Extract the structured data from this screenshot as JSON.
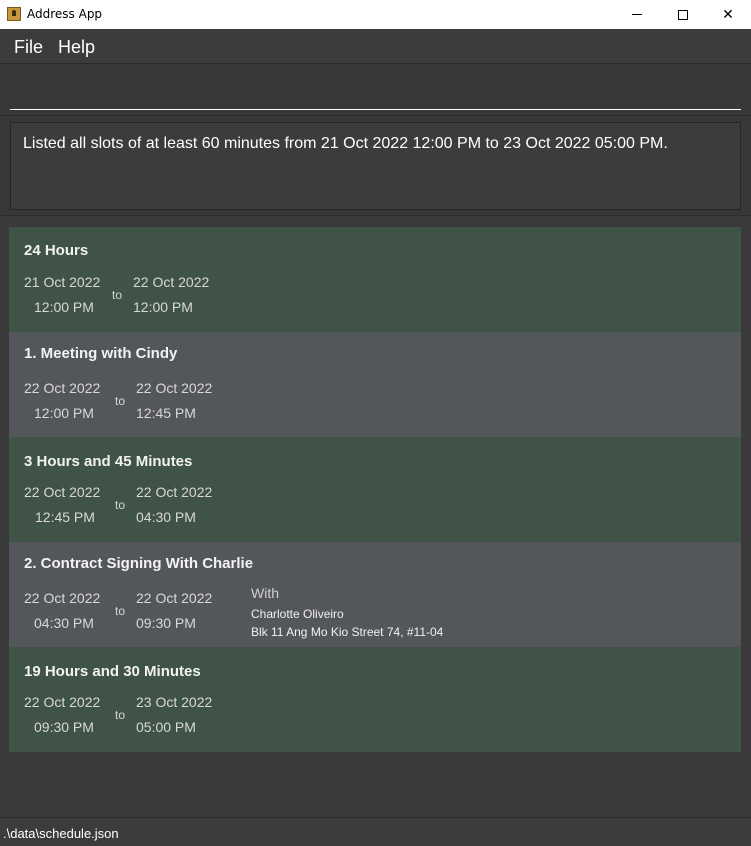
{
  "window": {
    "title": "Address App",
    "icon": "app-icon",
    "controls": {
      "minimize": "minimize-icon",
      "maximize": "maximize-icon",
      "close": "✕"
    }
  },
  "menu": {
    "file": "File",
    "help": "Help"
  },
  "command": {
    "value": "",
    "placeholder": ""
  },
  "result": {
    "message": "Listed all slots of at least 60 minutes from 21 Oct 2022 12:00 PM to 23 Oct 2022 05:00 PM."
  },
  "schedule": {
    "slots": [
      {
        "kind": "free",
        "title": "24 Hours",
        "start_date": "21 Oct 2022",
        "start_time": "12:00 PM",
        "to": "to",
        "end_date": "22 Oct 2022",
        "end_time": "12:00 PM"
      },
      {
        "kind": "event",
        "title": "1.  Meeting with Cindy",
        "start_date": "22 Oct 2022",
        "start_time": "12:00 PM",
        "to": "to",
        "end_date": "22 Oct 2022",
        "end_time": "12:45 PM"
      },
      {
        "kind": "free",
        "title": "3 Hours and 45 Minutes",
        "start_date": "22 Oct 2022",
        "start_time": "12:45 PM",
        "to": "to",
        "end_date": "22 Oct 2022",
        "end_time": "04:30 PM"
      },
      {
        "kind": "event",
        "title": "2.  Contract Signing With Charlie",
        "start_date": "22 Oct 2022",
        "start_time": "04:30 PM",
        "to": "to",
        "end_date": "22 Oct 2022",
        "end_time": "09:30 PM",
        "with_label": "With",
        "with_name": "Charlotte Oliveiro",
        "with_address": "Blk 11 Ang Mo Kio Street 74, #11-04"
      },
      {
        "kind": "free",
        "title": "19 Hours and 30 Minutes",
        "start_date": "22 Oct 2022",
        "start_time": "09:30 PM",
        "to": "to",
        "end_date": "23 Oct 2022",
        "end_time": "05:00 PM"
      }
    ]
  },
  "status": {
    "path": ".\\data\\schedule.json"
  },
  "colors": {
    "free_slot": "#3f5347",
    "event_slot": "#53575c",
    "background": "#3a3a3a"
  }
}
